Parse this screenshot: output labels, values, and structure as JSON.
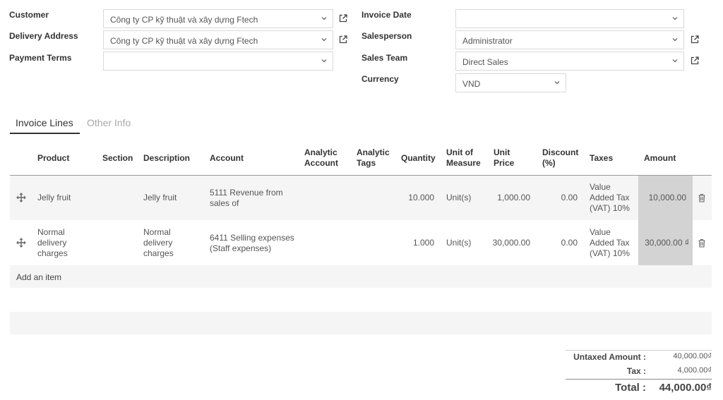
{
  "form": {
    "customer_label": "Customer",
    "customer_value": "Công ty CP kỹ thuật và xây dựng Ftech",
    "delivery_label": "Delivery Address",
    "delivery_value": "Công ty CP kỹ thuật và xây dựng Ftech",
    "payment_terms_label": "Payment Terms",
    "payment_terms_value": "",
    "invoice_date_label": "Invoice Date",
    "invoice_date_value": "",
    "salesperson_label": "Salesperson",
    "salesperson_value": "Administrator",
    "sales_team_label": "Sales Team",
    "sales_team_value": "Direct Sales",
    "currency_label": "Currency",
    "currency_value": "VND"
  },
  "tabs": {
    "invoice_lines": "Invoice Lines",
    "other_info": "Other Info",
    "active_color": "#333333",
    "inactive_color": "#a8a8a8"
  },
  "table": {
    "headers": {
      "product": "Product",
      "section": "Section",
      "description": "Description",
      "account": "Account",
      "analytic_account_1": "Analytic",
      "analytic_account_2": "Account",
      "analytic_tags_1": "Analytic",
      "analytic_tags_2": "Tags",
      "quantity": "Quantity",
      "uom_1": "Unit of",
      "uom_2": "Measure",
      "unit_price_1": "Unit",
      "unit_price_2": "Price",
      "discount_1": "Discount",
      "discount_2": "(%)",
      "taxes": "Taxes",
      "amount": "Amount"
    },
    "rows": [
      {
        "product": "Jelly fruit",
        "description": "Jelly fruit",
        "account_1": "5111 Revenue from",
        "account_2": "sales of",
        "quantity": "10.000",
        "uom": "Unit(s)",
        "unit_price": "1,000.00",
        "discount": "0.00",
        "taxes_1": "Value",
        "taxes_2": "Added Tax",
        "taxes_3": "(VAT) 10%",
        "amount": "10,000.00"
      },
      {
        "product_1": "Normal",
        "product_2": "delivery",
        "product_3": "charges",
        "description_1": "Normal",
        "description_2": "delivery",
        "description_3": "charges",
        "account_1": "6411 Selling expenses",
        "account_2": "(Staff expenses)",
        "quantity": "1.000",
        "uom": "Unit(s)",
        "unit_price": "30,000.00",
        "discount": "0.00",
        "taxes_1": "Value",
        "taxes_2": "Added Tax",
        "taxes_3": "(VAT) 10%",
        "amount": "30,000.00 ₫"
      }
    ],
    "add_item": "Add an item"
  },
  "totals": {
    "untaxed_label": "Untaxed Amount :",
    "untaxed_value": "40,000.00₫",
    "tax_label": "Tax :",
    "tax_value": "4,000.00₫",
    "total_label": "Total :",
    "total_value": "44,000.00₫"
  },
  "icons": {
    "dropdown": "chevron-down-icon",
    "external": "external-link-icon",
    "drag": "drag-handle-icon",
    "delete": "trash-icon"
  }
}
